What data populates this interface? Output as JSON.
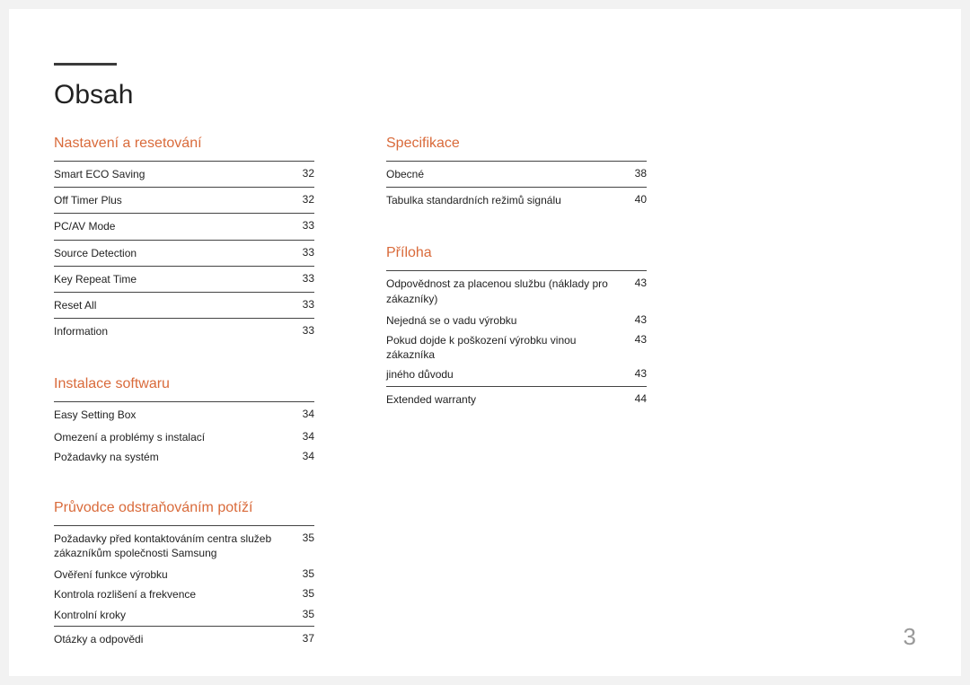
{
  "title": "Obsah",
  "page_number": "3",
  "col1": {
    "section1": {
      "title": "Nastavení a resetování",
      "items": [
        {
          "label": "Smart ECO Saving",
          "page": "32",
          "divider": true
        },
        {
          "label": "Off Timer Plus",
          "page": "32",
          "divider": true
        },
        {
          "label": "PC/AV Mode",
          "page": "33",
          "divider": true
        },
        {
          "label": "Source Detection",
          "page": "33",
          "divider": true
        },
        {
          "label": "Key Repeat Time",
          "page": "33",
          "divider": true
        },
        {
          "label": "Reset All",
          "page": "33",
          "divider": true
        },
        {
          "label": "Information",
          "page": "33",
          "divider": true
        }
      ]
    },
    "section2": {
      "title": "Instalace softwaru",
      "items": [
        {
          "label": "Easy Setting Box",
          "page": "34",
          "divider": true
        },
        {
          "label": "Omezení a problémy s instalací",
          "page": "34",
          "sub": true
        },
        {
          "label": "Požadavky na systém",
          "page": "34",
          "sub": true
        }
      ]
    },
    "section3": {
      "title": "Průvodce odstraňováním potíží",
      "items": [
        {
          "label": "Požadavky před kontaktováním centra služeb zákazníkům společnosti Samsung",
          "page": "35",
          "divider": true
        },
        {
          "label": "Ověření funkce výrobku",
          "page": "35",
          "sub": true
        },
        {
          "label": "Kontrola rozlišení a frekvence",
          "page": "35",
          "sub": true
        },
        {
          "label": "Kontrolní kroky",
          "page": "35",
          "sub": true
        },
        {
          "label": "Otázky a odpovědi",
          "page": "37",
          "divider": true
        }
      ]
    }
  },
  "col2": {
    "section1": {
      "title": "Specifikace",
      "items": [
        {
          "label": "Obecné",
          "page": "38",
          "divider": true
        },
        {
          "label": "Tabulka standardních režimů signálu",
          "page": "40",
          "divider": true
        }
      ]
    },
    "section2": {
      "title": "Příloha",
      "items": [
        {
          "label": "Odpovědnost za placenou službu (náklady pro zákazníky)",
          "page": "43",
          "divider": true
        },
        {
          "label": "Nejedná se o vadu výrobku",
          "page": "43",
          "sub": true
        },
        {
          "label": "Pokud dojde k poškození výrobku vinou zákazníka",
          "page": "43",
          "sub": true
        },
        {
          "label": "jiného důvodu",
          "page": "43",
          "sub": true
        },
        {
          "label": "Extended warranty",
          "page": "44",
          "divider": true
        }
      ]
    }
  }
}
